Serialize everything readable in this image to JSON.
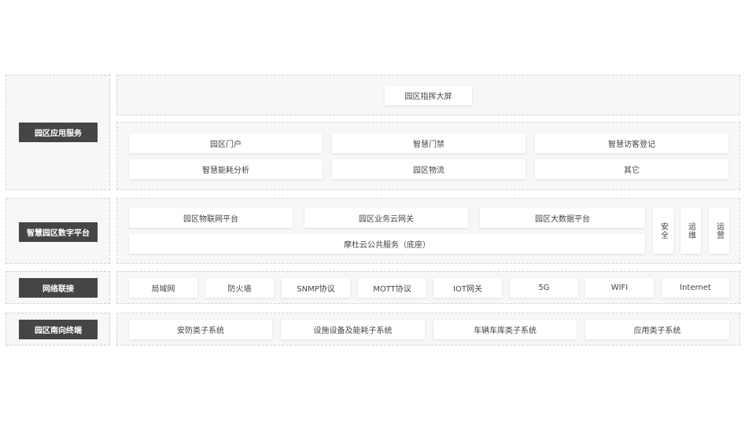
{
  "layers": {
    "application": {
      "label": "园区应用服务",
      "top_item": "园区指挥大屏",
      "items": [
        "园区门户",
        "智慧门禁",
        "智慧访客登记",
        "智慧能耗分析",
        "园区物流",
        "其它"
      ]
    },
    "digital_platform": {
      "label": "智慧园区数字平台",
      "platforms": [
        "园区物联网平台",
        "园区业务云网关",
        "园区大数据平台"
      ],
      "base": "摩杜云公共服务（底座）",
      "side": [
        "安全",
        "运维",
        "运营"
      ]
    },
    "network": {
      "label": "网络联接",
      "items": [
        "局域网",
        "防火墙",
        "SNMP协议",
        "MOTT协议",
        "IOT网关",
        "5G",
        "WIFI",
        "Internet"
      ]
    },
    "southbound": {
      "label": "园区南向终端",
      "items": [
        "安防类子系统",
        "设施设备及能耗子系统",
        "车辆车库类子系统",
        "应用类子系统"
      ]
    }
  }
}
